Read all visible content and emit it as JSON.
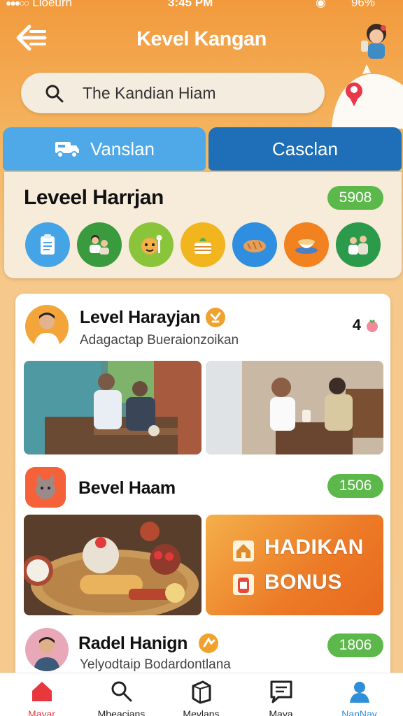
{
  "status_bar": {
    "carrier": "Lloeurh",
    "time": "3:45 PM",
    "battery": "96%"
  },
  "header": {
    "title": "Kevel Kangan"
  },
  "search": {
    "value": "The Kandian Hiam"
  },
  "tabs": [
    {
      "label": "Vanslan",
      "icon": "truck-icon"
    },
    {
      "label": "Casclan"
    }
  ],
  "levels_panel": {
    "heading": "Leveel Harrjan",
    "badge": "5908",
    "categories": [
      "clipboard-icon",
      "people-icon",
      "mascot-icon",
      "cake-icon",
      "bread-icon",
      "bowl-icon",
      "family-icon"
    ]
  },
  "posts": [
    {
      "title": "Level Harayjan",
      "subtitle": "Adagactap Bueraionzoikan",
      "count": "4"
    },
    {
      "title": "Bevel Haam",
      "badge": "1506"
    },
    {
      "title": "Radel Hanign",
      "subtitle": "Yelyodtaip Bodardontlana",
      "badge": "1806"
    }
  ],
  "bonus": {
    "line1": "HADIKAN",
    "line2": "BONUS"
  },
  "nav": [
    {
      "label": "Mayar",
      "icon": "home-icon",
      "active": true
    },
    {
      "label": "Mbeacians",
      "icon": "search-icon"
    },
    {
      "label": "Mevlans",
      "icon": "box-icon"
    },
    {
      "label": "Maya",
      "icon": "chat-list-icon"
    },
    {
      "label": "NanNav",
      "icon": "profile-icon"
    }
  ],
  "colors": {
    "accent_orange": "#f29a3d",
    "blue": "#4fa8e8",
    "dark_blue": "#1e6fb8",
    "green_badge": "#5cb84a",
    "nav_active": "#e8383d"
  }
}
